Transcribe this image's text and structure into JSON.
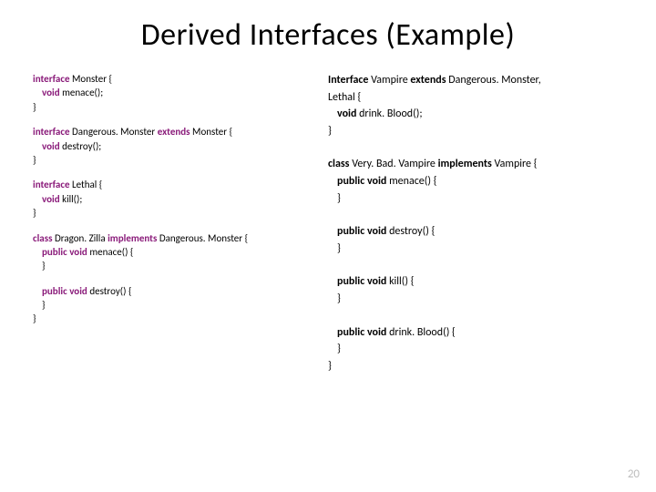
{
  "title": "Derived Interfaces (Example)",
  "page_number": "20",
  "left": {
    "kw_interface": "interface",
    "kw_extends": "extends",
    "kw_class": "class",
    "kw_implements": "implements",
    "kw_void": "void",
    "kw_public_void": "public void",
    "monster": {
      "name": "Monster {",
      "m1": "menace();",
      "close": "}"
    },
    "dangerous": {
      "decl": "Dangerous. Monster",
      "tail": "Monster {",
      "m1": "destroy();",
      "close": "}"
    },
    "lethal": {
      "name": "Lethal {",
      "m1": "kill();",
      "close": "}"
    },
    "dragon": {
      "decl": "Dragon. Zilla",
      "tail": "Dangerous. Monster {",
      "m1": "menace() {",
      "m1c": "}",
      "m2": "destroy() {",
      "m2c": "}",
      "close": "}"
    }
  },
  "right": {
    "kw_Interface": "Interface",
    "kw_extends": "extends",
    "kw_class": "class",
    "kw_implements": "implements",
    "kw_void": "void",
    "kw_public_void": "public void",
    "vampire": {
      "decl": "Vampire",
      "tail": "Dangerous. Monster,",
      "line2": "Lethal {",
      "m1": "drink. Blood();",
      "close": "}"
    },
    "vbv": {
      "decl": "Very. Bad. Vampire",
      "tail": "Vampire {",
      "m1": "menace() {",
      "m1c": "}",
      "m2": "destroy() {",
      "m2c": "}",
      "m3": "kill() {",
      "m3c": "}",
      "m4": "drink. Blood() {",
      "m4c": "}",
      "close": "}"
    }
  }
}
